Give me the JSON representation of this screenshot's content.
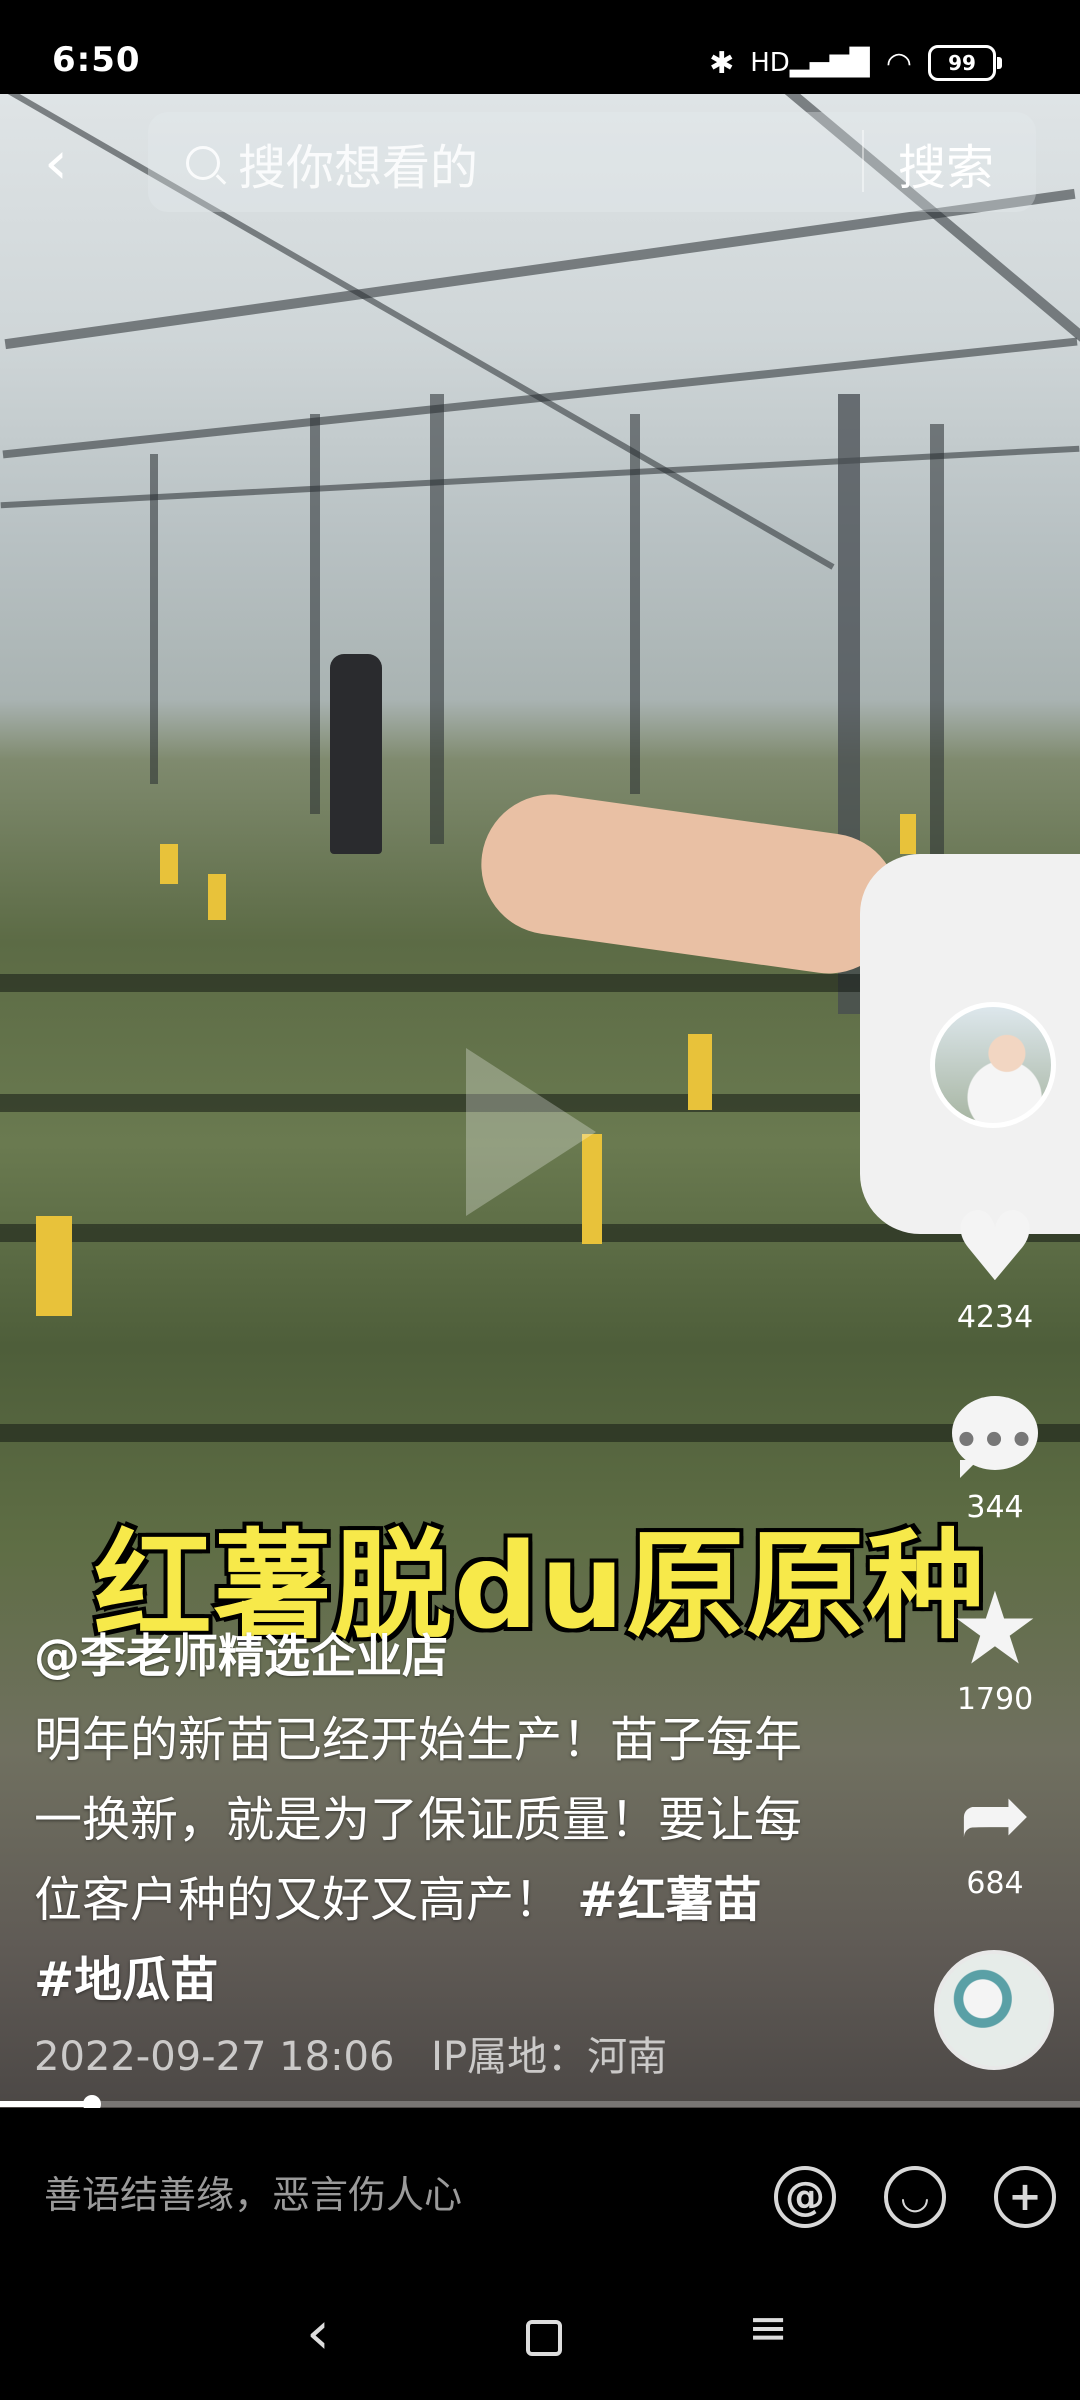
{
  "status_bar": {
    "time": "6:50",
    "icons": [
      "bluetooth-icon",
      "hd-signal-icon",
      "wifi-icon"
    ],
    "battery": "99"
  },
  "search": {
    "back_icon": "back-arrow-icon",
    "placeholder": "搜你想看的",
    "button_label": "搜索"
  },
  "video": {
    "overlay_caption": "红薯脱du原原种",
    "progress_fraction": 0.085
  },
  "right_rail": {
    "likes": "4234",
    "comments": "344",
    "favorites": "1790",
    "shares": "684"
  },
  "post": {
    "author": "@李老师精选企业店",
    "description": "明年的新苗已经开始生产！苗子每年一换新，就是为了保证质量！要让每位客户种的又好又高产！",
    "hashtags": [
      "#红薯苗",
      "#地瓜苗"
    ],
    "timestamp": "2022-09-27 18:06",
    "ip_location": "IP属地：河南"
  },
  "comment_bar": {
    "placeholder": "善语结善缘，恶言伤人心",
    "icons": [
      "at-icon",
      "emoji-icon",
      "add-icon"
    ]
  },
  "nav_bar": {
    "icons": [
      "nav-back-icon",
      "nav-home-icon",
      "nav-menu-icon"
    ]
  }
}
